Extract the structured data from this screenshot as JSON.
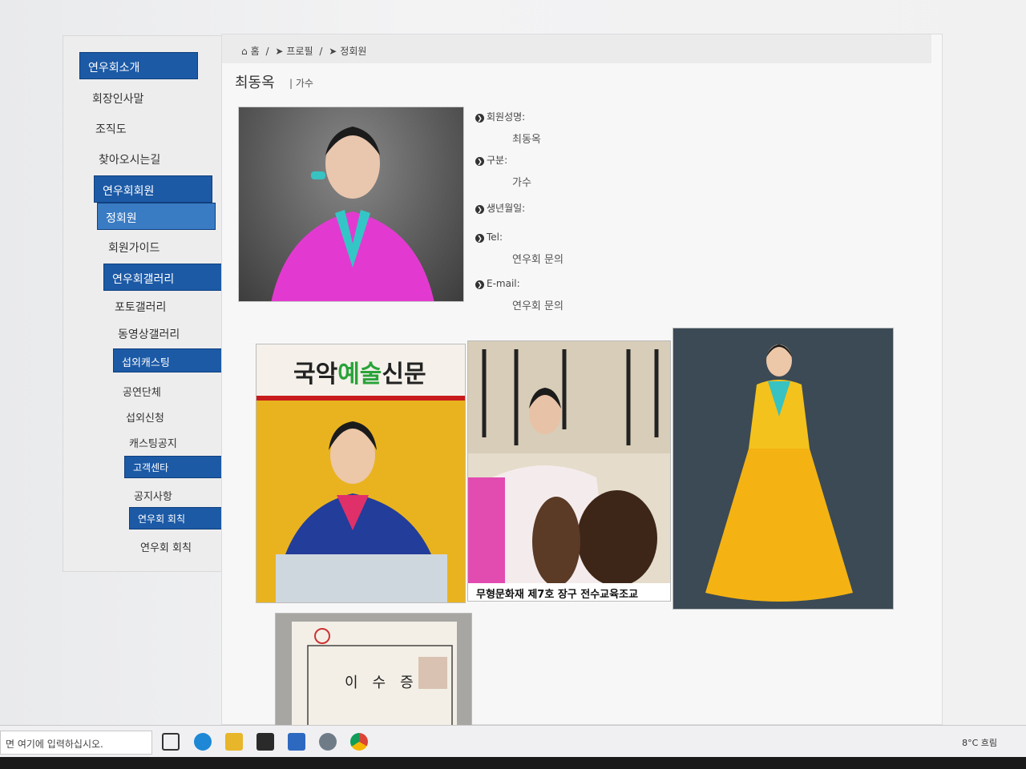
{
  "sidebar": {
    "sections": [
      {
        "title": "연우회소개",
        "items": [
          "회장인사말",
          "조직도",
          "찾아오시는길"
        ]
      },
      {
        "title": "연우회회원",
        "active_item": "정회원",
        "items": [
          "회원가이드"
        ]
      },
      {
        "title": "연우회갤러리",
        "items": [
          "포토갤러리",
          "동영상갤러리"
        ]
      },
      {
        "title": "섭외캐스팅",
        "items": [
          "공연단체",
          "섭외신청",
          "캐스팅공지"
        ]
      },
      {
        "title": "고객센타",
        "items": [
          "공지사항"
        ]
      },
      {
        "title": "연우회 회칙",
        "items": [
          "연우회 회칙"
        ]
      }
    ]
  },
  "breadcrumb": [
    "홈",
    "프로필",
    "정회원"
  ],
  "profile": {
    "name": "최동옥",
    "category": "가수",
    "fields": [
      {
        "label": "회원성명:",
        "value": "최동옥"
      },
      {
        "label": "구분:",
        "value": "가수"
      },
      {
        "label": "생년월일:",
        "value": ""
      },
      {
        "label": "Tel:",
        "value": "연우회 문의"
      },
      {
        "label": "E-mail:",
        "value": "연우회 문의"
      }
    ]
  },
  "gallery": {
    "newspaper_title_part1": "국악",
    "newspaper_title_part2": "예술",
    "newspaper_title_part3": "신문",
    "drum_caption": "무형문화재 제7호 장구 전수교육조교",
    "certificate_title": "이수증"
  },
  "taskbar": {
    "search_placeholder": "면 여기에 입력하십시오.",
    "weather": "8°C 흐림"
  },
  "colors": {
    "menu_blue": "#1c5aa6",
    "menu_active": "#3a7cc4"
  }
}
